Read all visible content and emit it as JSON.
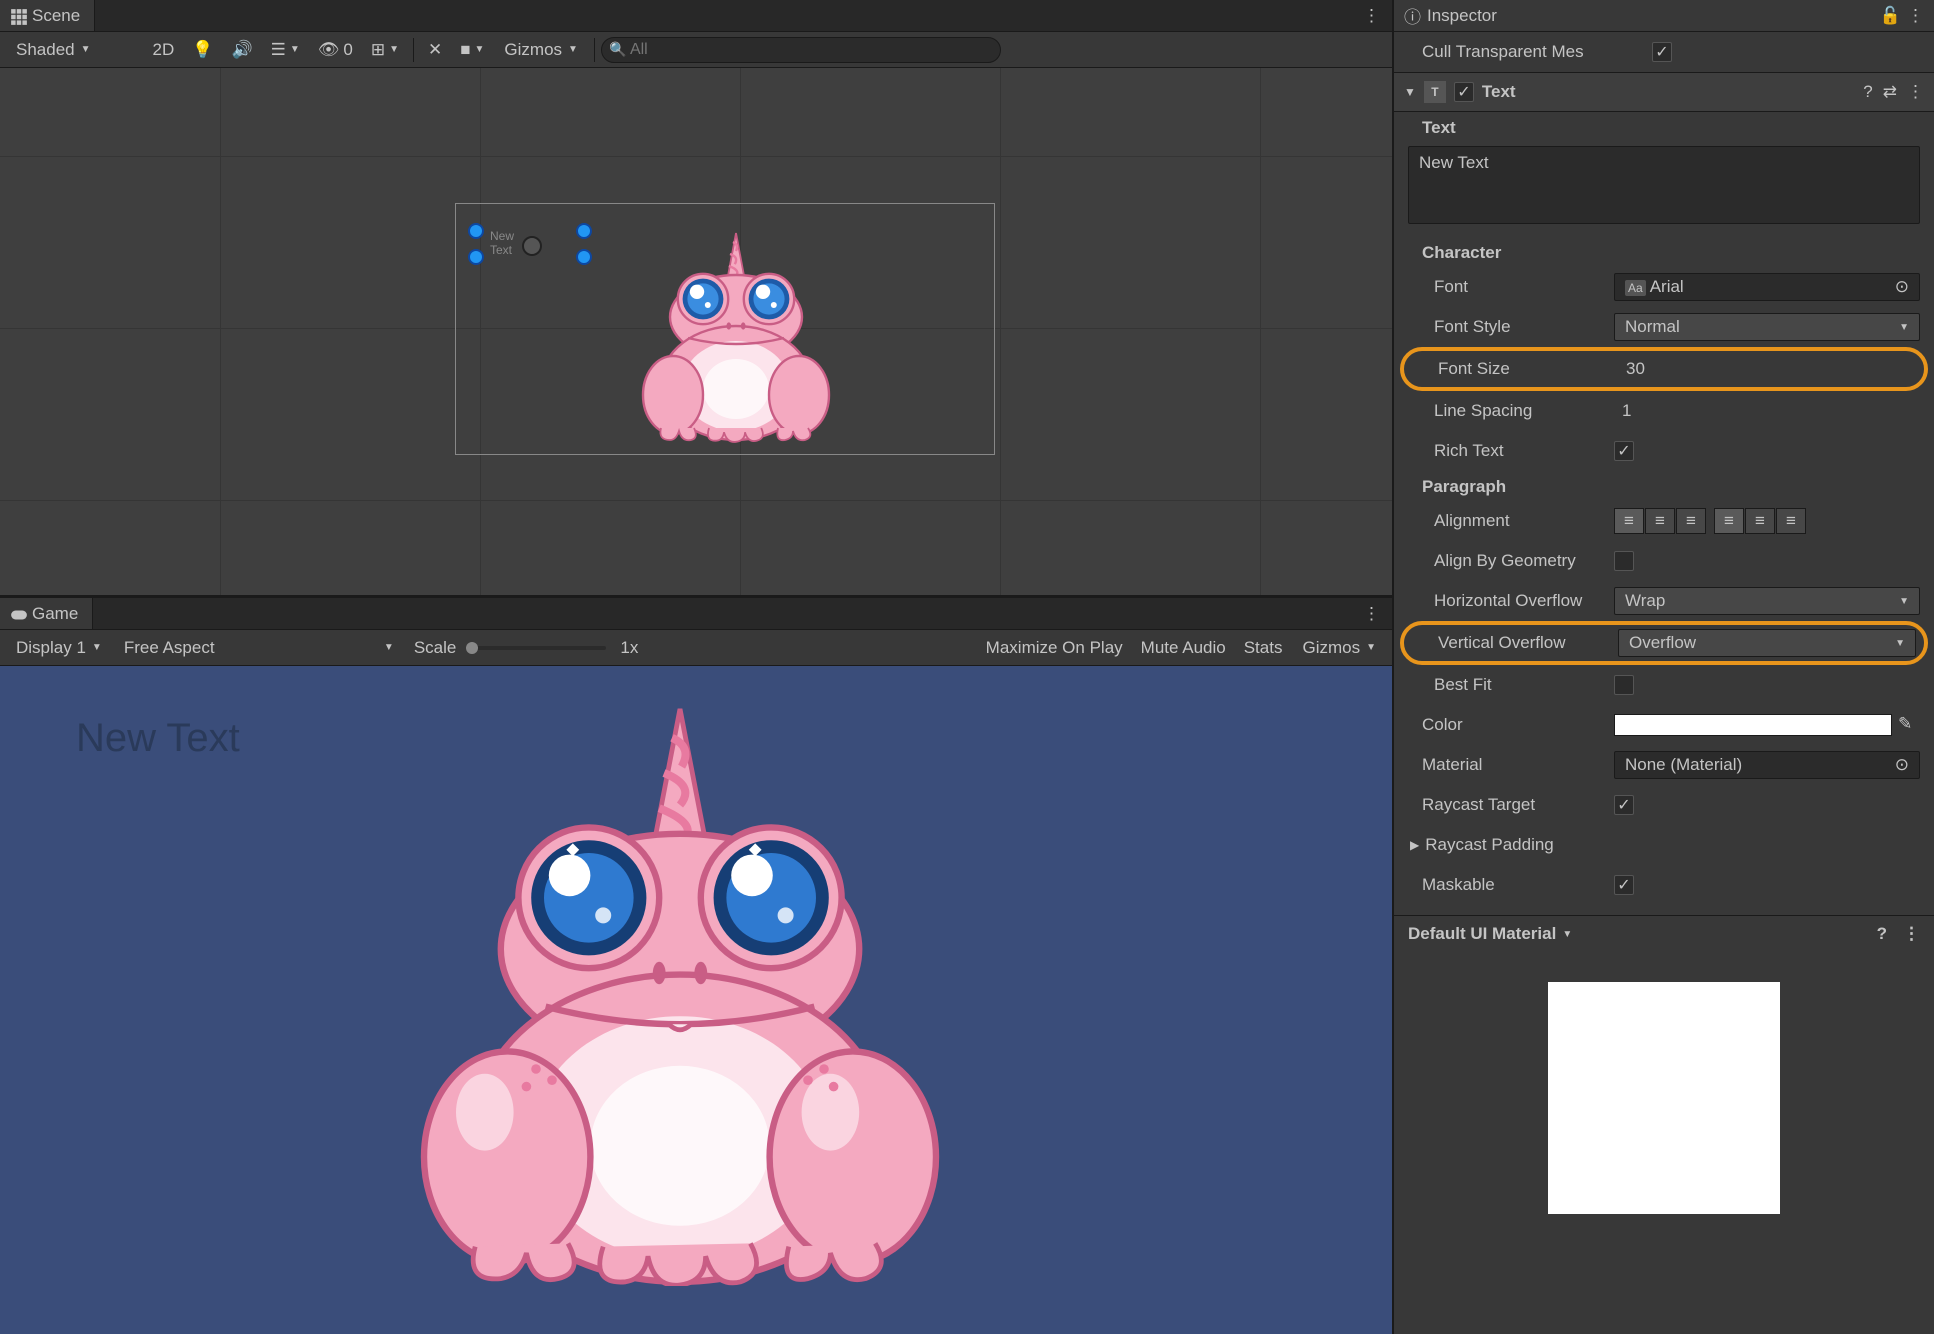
{
  "scene": {
    "tab_label": "Scene",
    "shading_mode": "Shaded",
    "mode_2d": "2D",
    "gizmos_label": "Gizmos",
    "strikeout_zero": "0",
    "search_placeholder": "All",
    "overlay_text": "New Text"
  },
  "game": {
    "tab_label": "Game",
    "display": "Display 1",
    "aspect": "Free Aspect",
    "scale_label": "Scale",
    "scale_value": "1x",
    "maximize": "Maximize On Play",
    "mute": "Mute Audio",
    "stats": "Stats",
    "gizmos": "Gizmos",
    "text_label": "New Text"
  },
  "inspector": {
    "tab_label": "Inspector",
    "cull_label": "Cull Transparent Mes",
    "component_name": "Text",
    "text_label": "Text",
    "text_value": "New Text",
    "character_header": "Character",
    "font_label": "Font",
    "font_value": "Arial",
    "fontstyle_label": "Font Style",
    "fontstyle_value": "Normal",
    "fontsize_label": "Font Size",
    "fontsize_value": "30",
    "linespacing_label": "Line Spacing",
    "linespacing_value": "1",
    "richtext_label": "Rich Text",
    "paragraph_header": "Paragraph",
    "alignment_label": "Alignment",
    "alignbygeom_label": "Align By Geometry",
    "hoverflow_label": "Horizontal Overflow",
    "hoverflow_value": "Wrap",
    "voverflow_label": "Vertical Overflow",
    "voverflow_value": "Overflow",
    "bestfit_label": "Best Fit",
    "color_label": "Color",
    "material_label": "Material",
    "material_value": "None (Material)",
    "raycast_label": "Raycast Target",
    "raycastpad_label": "Raycast Padding",
    "maskable_label": "Maskable",
    "defaultmat_label": "Default UI Material"
  }
}
